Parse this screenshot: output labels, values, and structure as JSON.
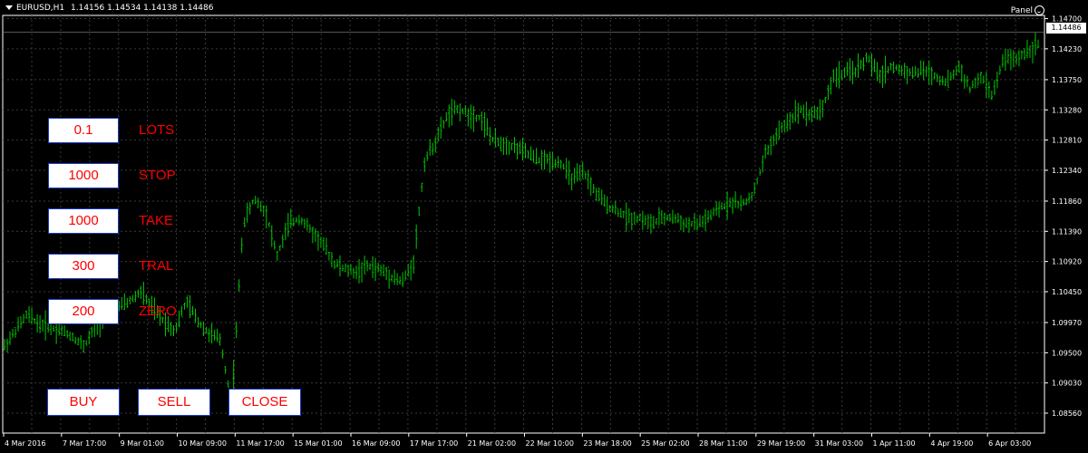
{
  "header": {
    "symbol": "EURUSD,H1",
    "ohlc": "1.14156 1.14534 1.14138 1.14486",
    "panel_label": "Panel"
  },
  "controls": {
    "lots": {
      "value": "0.1",
      "label": "LOTS"
    },
    "stop": {
      "value": "1000",
      "label": "STOP"
    },
    "take": {
      "value": "1000",
      "label": "TAKE"
    },
    "tral": {
      "value": "300",
      "label": "TRAL"
    },
    "zero": {
      "value": "200",
      "label": "ZERO"
    },
    "buy_label": "BUY",
    "sell_label": "SELL",
    "close_label": "CLOSE"
  },
  "current_price": "1.14486",
  "colors": {
    "background": "#000000",
    "grid": "#3a3a3a",
    "bars": "#00c800",
    "control_text": "#ff0000",
    "control_border": "#1a3ccc"
  },
  "chart_data": {
    "type": "line",
    "title": "EURUSD,H1",
    "ylim": [
      1.0825,
      1.1475
    ],
    "y_ticks": [
      "1.14700",
      "1.14230",
      "1.13750",
      "1.13280",
      "1.12810",
      "1.12340",
      "1.11860",
      "1.11390",
      "1.10920",
      "1.10450",
      "1.09970",
      "1.09500",
      "1.09030",
      "1.08560"
    ],
    "y_values": [
      1.147,
      1.1423,
      1.1375,
      1.1328,
      1.1281,
      1.1234,
      1.1186,
      1.1139,
      1.1092,
      1.1045,
      1.0997,
      1.095,
      1.0903,
      1.0856
    ],
    "x_ticks": [
      "4 Mar 2016",
      "7 Mar 17:00",
      "9 Mar 01:00",
      "10 Mar 09:00",
      "11 Mar 17:00",
      "15 Mar 01:00",
      "16 Mar 09:00",
      "17 Mar 17:00",
      "21 Mar 02:00",
      "22 Mar 10:00",
      "23 Mar 18:00",
      "25 Mar 02:00",
      "28 Mar 11:00",
      "29 Mar 19:00",
      "31 Mar 03:00",
      "1 Apr 11:00",
      "4 Apr 19:00",
      "6 Apr 03:00"
    ],
    "series": [
      {
        "values": [
          1.096,
          1.0985,
          1.101,
          1.0995,
          1.099,
          1.0985,
          1.0975,
          1.096,
          1.099,
          1.101,
          1.102,
          1.103,
          1.1045,
          1.102,
          1.1,
          1.0985,
          1.103,
          1.1,
          1.098,
          1.097,
          1.087,
          1.115,
          1.119,
          1.117,
          1.11,
          1.115,
          1.116,
          1.114,
          1.112,
          1.109,
          1.108,
          1.1075,
          1.1085,
          1.108,
          1.107,
          1.106,
          1.109,
          1.125,
          1.128,
          1.132,
          1.133,
          1.132,
          1.1315,
          1.128,
          1.1275,
          1.127,
          1.126,
          1.125,
          1.125,
          1.1245,
          1.122,
          1.123,
          1.12,
          1.118,
          1.117,
          1.116,
          1.116,
          1.115,
          1.116,
          1.116,
          1.115,
          1.115,
          1.116,
          1.1175,
          1.1185,
          1.118,
          1.12,
          1.126,
          1.129,
          1.131,
          1.133,
          1.132,
          1.133,
          1.138,
          1.1385,
          1.139,
          1.141,
          1.138,
          1.1395,
          1.139,
          1.1385,
          1.139,
          1.138,
          1.137,
          1.1395,
          1.136,
          1.138,
          1.135,
          1.141,
          1.1405,
          1.142,
          1.143
        ]
      }
    ]
  }
}
